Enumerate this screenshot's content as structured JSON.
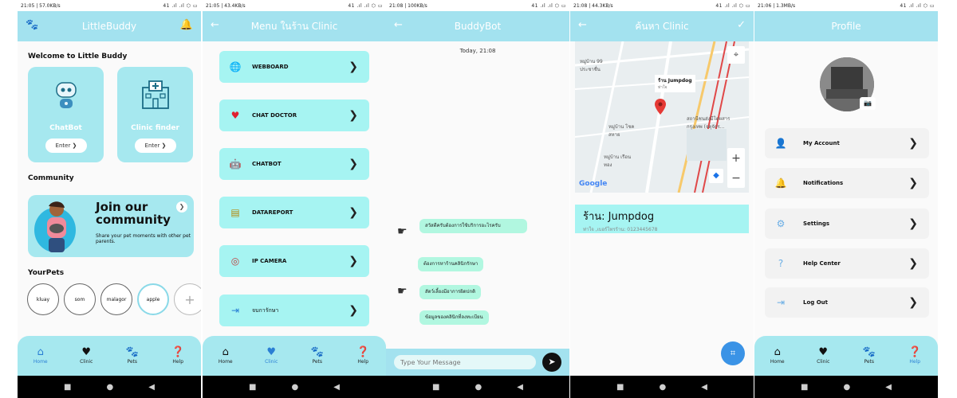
{
  "panel1": {
    "status": {
      "left": "21:05 | 57.0KB/s",
      "right": "41 .ıl .ıl ⬡ ▭"
    },
    "appbar": {
      "title": "LittleBuddy"
    },
    "welcome": "Welcome to Little Buddy",
    "cards": [
      {
        "title": "ChatBot",
        "button": "Enter ❯"
      },
      {
        "title": "Clinic finder",
        "button": "Enter ❯"
      }
    ],
    "community_heading": "Community",
    "banner": {
      "title": "Join our community",
      "subtitle": "Share your pet moments with other pet parents."
    },
    "yourpets_heading": "YourPets",
    "pets": [
      "kluay",
      "som",
      "malagor",
      "apple"
    ],
    "add_pet": "+"
  },
  "panel2": {
    "status": {
      "left": "21:05 | 43.4KB/s",
      "right": "41 .ıl .ıl ⬡ ▭"
    },
    "appbar": {
      "title": "Menu ในร้าน Clinic",
      "back": "←"
    },
    "menu": [
      {
        "label": "WEBBOARD",
        "icon": "🌐"
      },
      {
        "label": "CHAT DOCTOR",
        "icon": "♥"
      },
      {
        "label": "CHATBOT",
        "icon": "🤖"
      },
      {
        "label": "DATAREPORT",
        "icon": "▤"
      },
      {
        "label": "IP CAMERA",
        "icon": "◎"
      },
      {
        "label": "จบการักษา",
        "icon": "⇥"
      }
    ]
  },
  "panel3": {
    "status": {
      "left": "21:08 | 100KB/s",
      "right": "41 .ıl .ıl ⬡ ▭"
    },
    "appbar": {
      "title": "BuddyBot",
      "back": "←"
    },
    "date": "Today, 21:08",
    "messages": [
      "สวัสดีครับต้องการใช้บริการอะไรครับ",
      "ต้องการหาร้านคลินิกรักษา",
      "สัตว์เลี้ยงมีอาการผิดปกติ",
      "ข้อมูลของคลินิกที่ลงทะเบียน"
    ],
    "input_placeholder": "Type Your Message"
  },
  "panel4": {
    "status": {
      "left": "21:08 | 44.3KB/s",
      "right": "41 .ıl .ıl ⬡ ▭"
    },
    "appbar": {
      "title": "ค้นหา Clinic",
      "back": "←",
      "confirm": "✓"
    },
    "map": {
      "label_title": "ร้าน Jumpdog",
      "label_sub": "ท่าใจ",
      "google": "Google",
      "zoom_in": "+",
      "zoom_out": "−",
      "area_labels": [
        "หมู่บ้าน 99 ประชาชื่น",
        "หมู่บ้าน โชคสหาย",
        "หมู่บ้าน เรือนทอง",
        "สถานีชนส่งมีโดยสาร กรุงเทพ (จตุจักร..."
      ]
    },
    "place_name": "ร้าน: Jumpdog",
    "place_sub": "ท่าใจ ,เบอร์โทรร้าน: 0123445678"
  },
  "panel5": {
    "status": {
      "left": "21:06 | 1.3MB/s",
      "right": "41 .ıl .ıl ⬡ ▭"
    },
    "appbar": {
      "title": "Profile"
    },
    "items": [
      {
        "label": "My Account",
        "icon": "👤"
      },
      {
        "label": "Notifications",
        "icon": "🔔"
      },
      {
        "label": "Settings",
        "icon": "⚙"
      },
      {
        "label": "Help Center",
        "icon": "?"
      },
      {
        "label": "Log Out",
        "icon": "⇥"
      }
    ]
  },
  "bottomnav": {
    "home": "Home",
    "clinic": "Clinic",
    "pets": "Pets",
    "help": "Help"
  },
  "colors": {
    "accent": "#a3e2ef",
    "item_bg": "#a6f4f2",
    "active": "#2a7fd4",
    "bubble": "#b1f7e0"
  }
}
